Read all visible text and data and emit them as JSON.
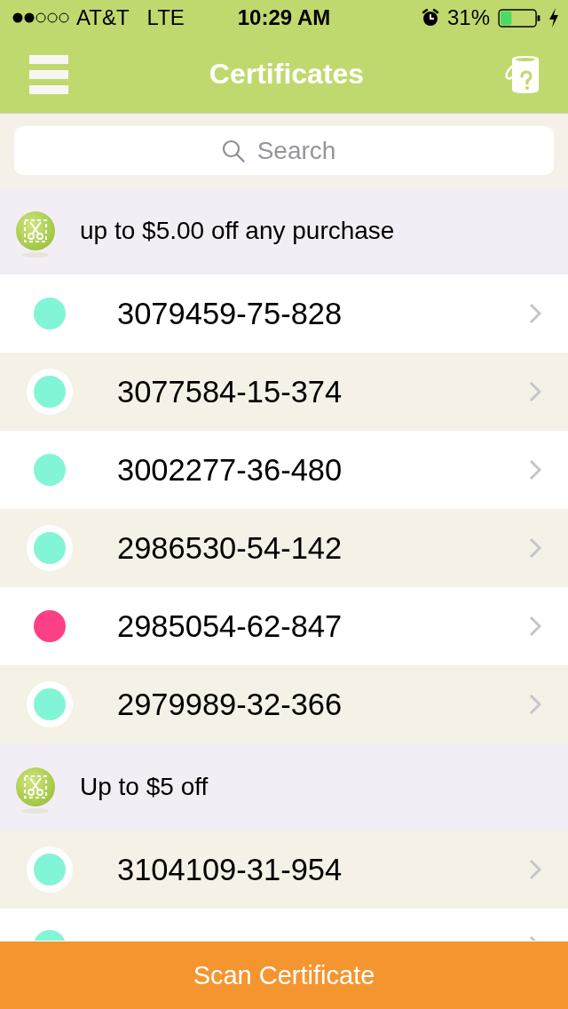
{
  "status_bar": {
    "carrier": "AT&T",
    "network": "LTE",
    "time": "10:29 AM",
    "battery": "31%"
  },
  "nav_bar": {
    "title": "Certificates"
  },
  "search": {
    "placeholder": "Search"
  },
  "sections": [
    {
      "title": "up to $5.00 off any purchase",
      "certificates": [
        {
          "number": "3079459-75-828",
          "color": "#82f5d6"
        },
        {
          "number": "3077584-15-374",
          "color": "#82f5d6"
        },
        {
          "number": "3002277-36-480",
          "color": "#82f5d6"
        },
        {
          "number": "2986530-54-142",
          "color": "#82f5d6"
        },
        {
          "number": "2985054-62-847",
          "color": "#fd3f85"
        },
        {
          "number": "2979989-32-366",
          "color": "#82f5d6"
        }
      ]
    },
    {
      "title": "Up to $5 off",
      "certificates": [
        {
          "number": "3104109-31-954",
          "color": "#82f5d6"
        },
        {
          "color": "#82f5d6"
        }
      ]
    }
  ],
  "bottom_button": {
    "label": "Scan Certificate"
  }
}
